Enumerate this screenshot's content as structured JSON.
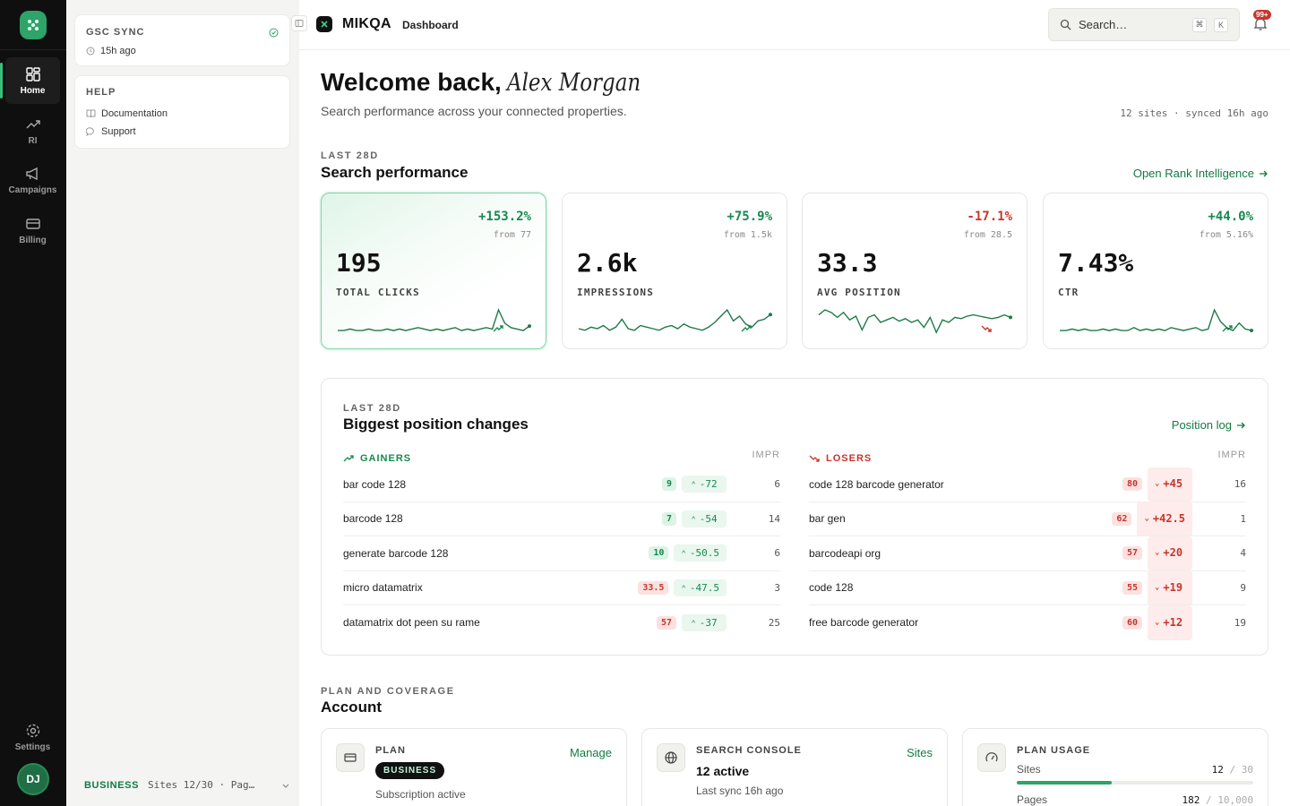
{
  "rail": {
    "items": [
      {
        "label": "Home"
      },
      {
        "label": "RI"
      },
      {
        "label": "Campaigns"
      },
      {
        "label": "Billing"
      }
    ],
    "settings": "Settings",
    "avatar": "DJ"
  },
  "side": {
    "sync_title": "GSC SYNC",
    "sync_time": "15h ago",
    "help_title": "HELP",
    "help_items": [
      "Documentation",
      "Support"
    ],
    "plan_badge": "BUSINESS",
    "plan_text": "Sites 12/30 · Pag…"
  },
  "header": {
    "brand": "MIKQA",
    "page": "Dashboard",
    "search_placeholder": "Search…",
    "kbd1": "⌘",
    "kbd2": "K",
    "notif": "99+"
  },
  "welcome": {
    "title": "Welcome back,",
    "name": "Alex Morgan",
    "subtitle": "Search performance across your connected properties.",
    "meta": "12 sites · synced 16h ago"
  },
  "perf": {
    "eyebrow": "LAST 28D",
    "title": "Search performance",
    "link": "Open Rank Intelligence",
    "kpis": [
      {
        "delta": "+153.2%",
        "from": "from 77",
        "value": "195",
        "name": "TOTAL CLICKS",
        "trend": "up",
        "spark": [
          3,
          3,
          4,
          3,
          3,
          4,
          3,
          3,
          4,
          3,
          4,
          3,
          4,
          5,
          4,
          3,
          4,
          3,
          4,
          5,
          3,
          4,
          3,
          4,
          5,
          4,
          17,
          8,
          5,
          4,
          3,
          6
        ]
      },
      {
        "delta": "+75.9%",
        "from": "from 1.5k",
        "value": "2.6k",
        "name": "IMPRESSIONS",
        "trend": "up",
        "spark": [
          4,
          3,
          5,
          4,
          6,
          3,
          5,
          10,
          4,
          3,
          6,
          5,
          4,
          3,
          5,
          6,
          4,
          7,
          5,
          4,
          3,
          5,
          8,
          12,
          16,
          9,
          12,
          7,
          5,
          9,
          10,
          13
        ]
      },
      {
        "delta": "-17.1%",
        "from": "from 28.5",
        "value": "33.3",
        "name": "AVG POSITION",
        "trend": "down",
        "spark": [
          16,
          20,
          18,
          14,
          18,
          12,
          15,
          4,
          14,
          16,
          10,
          12,
          14,
          11,
          13,
          10,
          12,
          6,
          14,
          2,
          12,
          10,
          14,
          13,
          15,
          16,
          15,
          14,
          13,
          14,
          16,
          14
        ]
      },
      {
        "delta": "+44.0%",
        "from": "from 5.16%",
        "value": "7.43%",
        "name": "CTR",
        "trend": "up",
        "spark": [
          3,
          3,
          4,
          3,
          4,
          3,
          3,
          4,
          3,
          4,
          3,
          3,
          5,
          3,
          4,
          3,
          4,
          3,
          5,
          4,
          3,
          4,
          5,
          3,
          4,
          17,
          9,
          5,
          3,
          8,
          4,
          3
        ]
      }
    ]
  },
  "changes": {
    "eyebrow": "LAST 28D",
    "title": "Biggest position changes",
    "link": "Position log",
    "gainers_label": "GAINERS",
    "losers_label": "LOSERS",
    "impr_label": "IMPR",
    "gainers": [
      {
        "q": "bar code 128",
        "pos": "9",
        "chg": "-72",
        "impr": "6"
      },
      {
        "q": "barcode 128",
        "pos": "7",
        "chg": "-54",
        "impr": "14"
      },
      {
        "q": "generate barcode 128",
        "pos": "10",
        "chg": "-50.5",
        "impr": "6"
      },
      {
        "q": "micro datamatrix",
        "pos": "33.5",
        "chg": "-47.5",
        "impr": "3"
      },
      {
        "q": "datamatrix dot peen su rame",
        "pos": "57",
        "chg": "-37",
        "impr": "25"
      }
    ],
    "losers": [
      {
        "q": "code 128 barcode generator",
        "pos": "80",
        "chg": "+45",
        "impr": "16"
      },
      {
        "q": "bar gen",
        "pos": "62",
        "chg": "+42.5",
        "impr": "1"
      },
      {
        "q": "barcodeapi org",
        "pos": "57",
        "chg": "+20",
        "impr": "4"
      },
      {
        "q": "code 128",
        "pos": "55",
        "chg": "+19",
        "impr": "9"
      },
      {
        "q": "free barcode generator",
        "pos": "60",
        "chg": "+12",
        "impr": "19"
      }
    ]
  },
  "account": {
    "eyebrow": "PLAN AND COVERAGE",
    "title": "Account",
    "plan": {
      "title": "PLAN",
      "action": "Manage",
      "badge": "BUSINESS",
      "status": "Subscription active"
    },
    "gsc": {
      "title": "SEARCH CONSOLE",
      "action": "Sites",
      "value": "12 active",
      "sub": "Last sync 16h ago"
    },
    "usage": {
      "title": "PLAN USAGE",
      "sites_label": "Sites",
      "sites_used": "12",
      "sites_total": "30",
      "sites_fraction": 0.4,
      "pages_label": "Pages",
      "pages_used": "182",
      "pages_total": "10,000"
    }
  }
}
